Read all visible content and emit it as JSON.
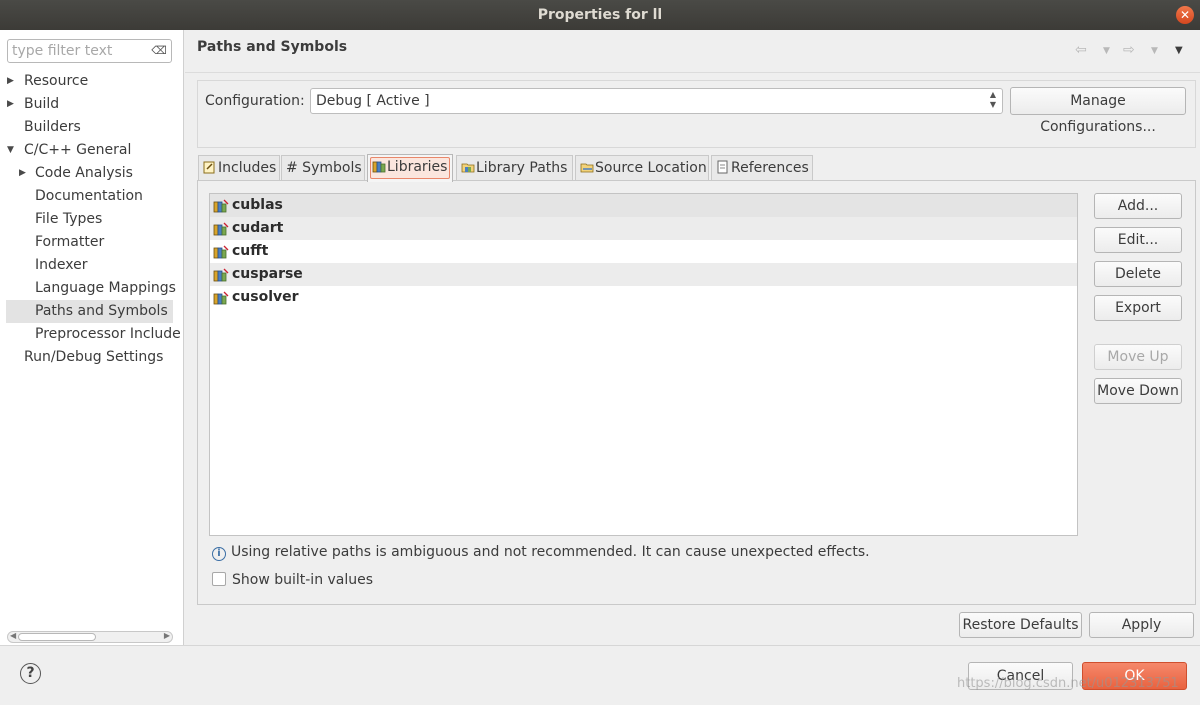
{
  "window": {
    "title": "Properties for ll"
  },
  "left": {
    "filter_placeholder": "type filter text",
    "tree": [
      {
        "label": "Resource",
        "arrow": true,
        "indent": 0
      },
      {
        "label": "Build",
        "arrow": true,
        "indent": 0
      },
      {
        "label": "Builders",
        "arrow": false,
        "indent": 0
      },
      {
        "label": "C/C++ General",
        "arrow": "down",
        "indent": 0
      },
      {
        "label": "Code Analysis",
        "arrow": true,
        "indent": 1
      },
      {
        "label": "Documentation",
        "arrow": false,
        "indent": 1
      },
      {
        "label": "File Types",
        "arrow": false,
        "indent": 1
      },
      {
        "label": "Formatter",
        "arrow": false,
        "indent": 1
      },
      {
        "label": "Indexer",
        "arrow": false,
        "indent": 1
      },
      {
        "label": "Language Mappings",
        "arrow": false,
        "indent": 1
      },
      {
        "label": "Paths and Symbols",
        "arrow": false,
        "indent": 1,
        "selected": true
      },
      {
        "label": "Preprocessor Include",
        "arrow": false,
        "indent": 1
      },
      {
        "label": "Run/Debug Settings",
        "arrow": false,
        "indent": 0
      }
    ]
  },
  "page": {
    "title": "Paths and Symbols",
    "config_label": "Configuration:",
    "config_value": "Debug  [ Active ]",
    "manage_button": "Manage Configurations...",
    "tabs": [
      "Includes",
      "# Symbols",
      "Libraries",
      "Library Paths",
      "Source Location",
      "References"
    ],
    "active_tab": "Libraries",
    "libraries": [
      "cublas",
      "cudart",
      "cufft",
      "cusparse",
      "cusolver"
    ],
    "side_buttons": {
      "add": "Add...",
      "edit": "Edit...",
      "delete": "Delete",
      "export": "Export",
      "move_up": "Move Up",
      "move_down": "Move Down"
    },
    "info_text": "Using relative paths is ambiguous and not recommended. It can cause unexpected effects.",
    "show_builtin": "Show built-in values",
    "restore_defaults": "Restore Defaults",
    "apply": "Apply"
  },
  "footer": {
    "cancel": "Cancel",
    "ok": "OK",
    "watermark": "https://blog.csdn.net/u012313751"
  },
  "colors": {
    "accent": "#e9623f",
    "titlebar": "#3c3b37"
  }
}
